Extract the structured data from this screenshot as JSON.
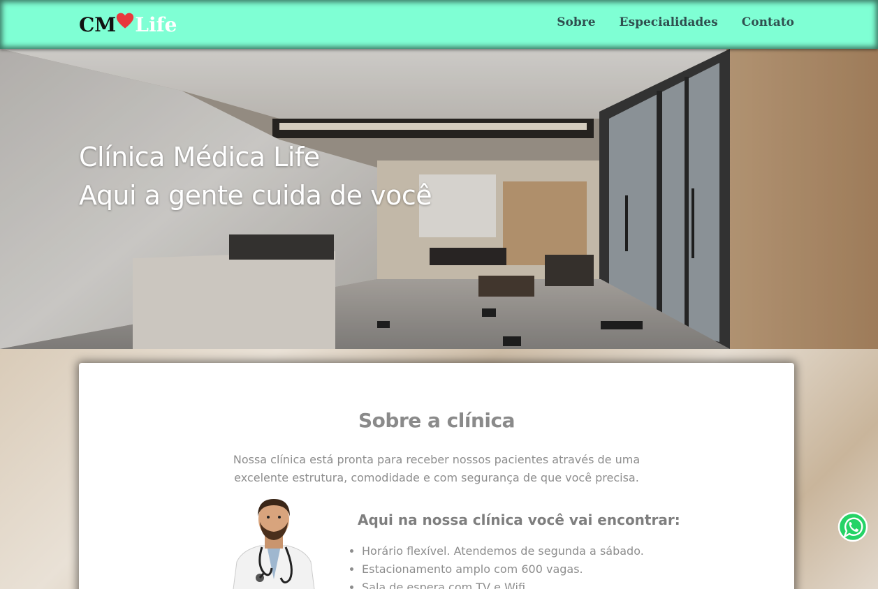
{
  "header": {
    "logo": {
      "part1": "CM",
      "part2": "Life",
      "heart_icon": "heart-icon"
    },
    "nav": [
      "Sobre",
      "Especialidades",
      "Contato"
    ]
  },
  "hero": {
    "line1": "Clínica Médica Life",
    "line2": "Aqui a gente cuida de você"
  },
  "about": {
    "title": "Sobre a clínica",
    "intro": "Nossa clínica está pronta para receber nossos pacientes através de uma excelente estrutura, comodidade e com segurança de que você precisa.",
    "features_title": "Aqui na nossa clínica você vai encontrar:",
    "features": [
      "Horário flexível. Atendemos de segunda a sábado.",
      "Estacionamento amplo com 600 vagas.",
      "Sala de espera com TV e Wifi"
    ]
  },
  "colors": {
    "header_bg": "#7fffd4",
    "nav_text": "#2f4f4f",
    "heart": "#e8383d",
    "whatsapp": "#25d366"
  }
}
